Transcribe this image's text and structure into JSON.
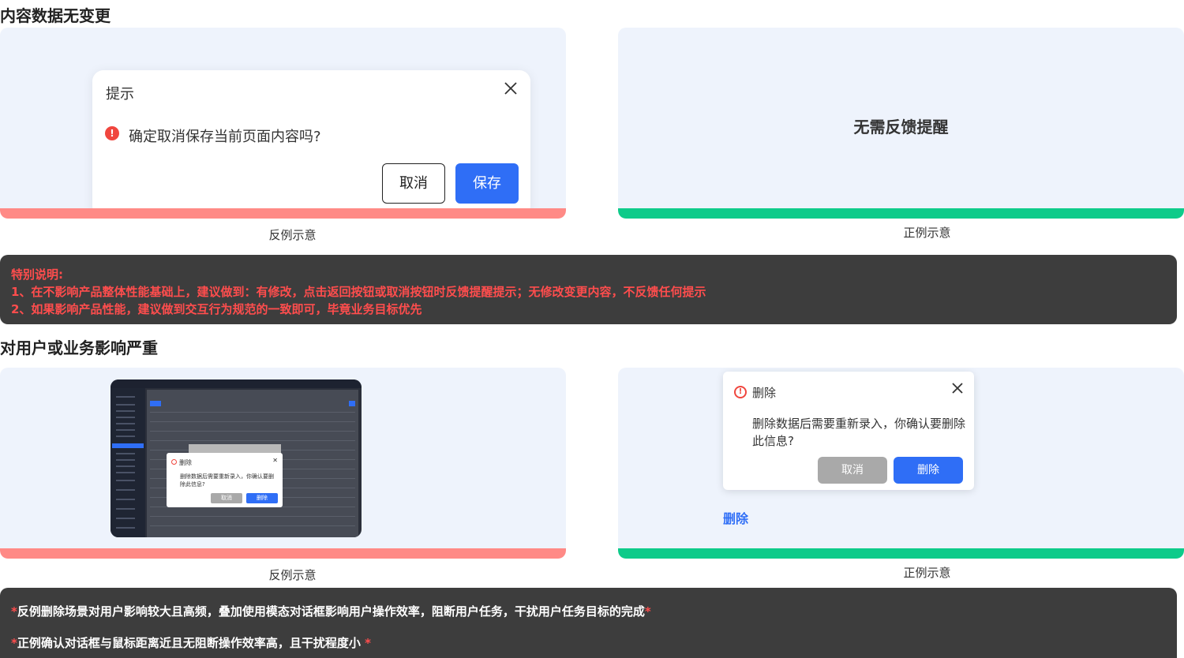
{
  "section1": {
    "heading": "内容数据无变更",
    "bad_example": {
      "dialog": {
        "title": "提示",
        "message": "确定取消保存当前页面内容吗?",
        "cancel_label": "取消",
        "save_label": "保存"
      },
      "caption": "反例示意",
      "bar_color": "#ff8a86"
    },
    "good_example": {
      "text": "无需反馈提醒",
      "caption": "正例示意",
      "bar_color": "#0ecb8a"
    }
  },
  "note1": {
    "title": "特别说明:",
    "line1": "1、在不影响产品整体性能基础上，建议做到：有修改，点击返回按钮或取消按钮时反馈提醒提示；无修改变更内容，不反馈任何提示",
    "line2": "2、如果影响产品性能，建议做到交互行为规范的一致即可，毕竟业务目标优先"
  },
  "section2": {
    "heading": "对用户或业务影响严重",
    "bad_example": {
      "mini_dialog": {
        "title": "删除",
        "message": "删除数据后需要重新录入，你确认要删除此信息?",
        "cancel_label": "取消",
        "delete_label": "删除"
      },
      "caption": "反例示意"
    },
    "good_example": {
      "dialog": {
        "title": "删除",
        "message": "删除数据后需要重新录入，你确认要删除此信息?",
        "cancel_label": "取消",
        "delete_label": "删除"
      },
      "link_label": "删除",
      "caption": "正例示意"
    }
  },
  "note2": {
    "line1": "反例删除场景对用户影响较大且高频，叠加使用模态对话框影响用户操作效率，阻断用户任务，干扰用户任务目标的完成",
    "line2": "正例确认对话框与鼠标距离近且无阻断操作效率高，且干扰程度小 ",
    "asterisk": "*"
  },
  "colors": {
    "accent_blue": "#2f6ef6",
    "warning_red": "#f0463e",
    "panel_bg": "#eef3fc",
    "note_bg": "#3d3d3d"
  }
}
